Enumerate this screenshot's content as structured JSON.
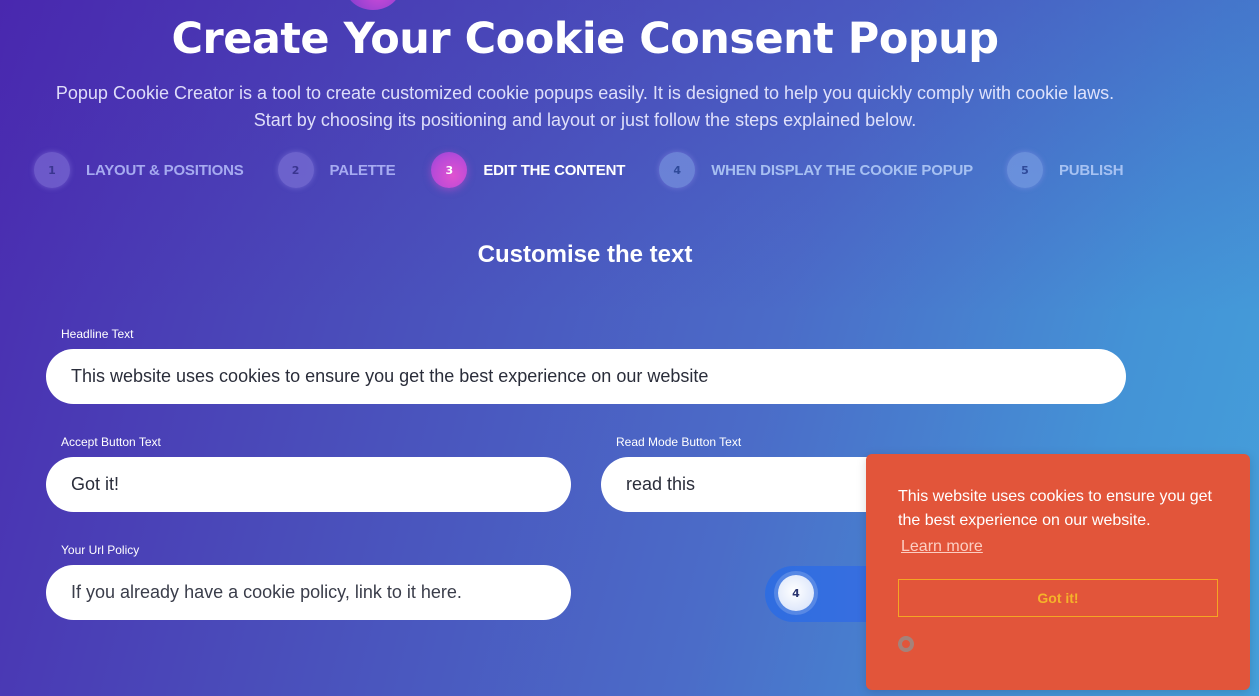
{
  "header": {
    "title": "Create Your Cookie Consent Popup",
    "subtitle_line1": "Popup Cookie Creator is a tool to create customized cookie popups easily. It is designed to help you quickly comply with cookie laws.",
    "subtitle_line2": "Start by choosing its positioning and layout or just follow the steps explained below."
  },
  "steps": [
    {
      "number": "1",
      "label": "LAYOUT & POSITIONS",
      "state": "inactive"
    },
    {
      "number": "2",
      "label": "PALETTE",
      "state": "inactive"
    },
    {
      "number": "3",
      "label": "EDIT THE CONTENT",
      "state": "active"
    },
    {
      "number": "4",
      "label": "WHEN DISPLAY THE COOKIE POPUP",
      "state": "inactive"
    },
    {
      "number": "5",
      "label": "PUBLISH",
      "state": "inactive"
    }
  ],
  "section": {
    "heading": "Customise the text"
  },
  "form": {
    "headline": {
      "label": "Headline Text",
      "value": "This website uses cookies to ensure you get the best experience on our website"
    },
    "accept_button": {
      "label": "Accept Button Text",
      "value": "Got it!"
    },
    "read_more_button": {
      "label": "Read Mode Button Text",
      "value": "read this"
    },
    "url_policy": {
      "label": "Your Url Policy",
      "placeholder": "If you already have a cookie policy, link to it here."
    }
  },
  "navigation": {
    "next_step_number": "4"
  },
  "cookie_preview": {
    "message": "This website uses cookies to ensure you get the best experience on our website.",
    "learn_more": "Learn more",
    "accept_button": "Got it!",
    "revoke_icon": "cookie-revoke-icon",
    "colors": {
      "background": "#e2553a",
      "button_border": "#f5a623",
      "button_text": "#f5b32a"
    }
  }
}
